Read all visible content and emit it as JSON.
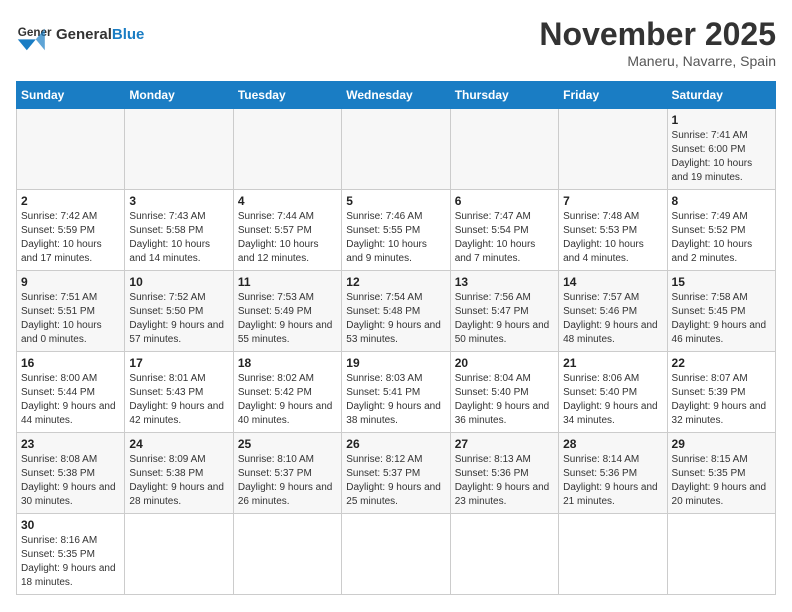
{
  "header": {
    "logo_general": "General",
    "logo_blue": "Blue",
    "month_title": "November 2025",
    "location": "Maneru, Navarre, Spain"
  },
  "days_of_week": [
    "Sunday",
    "Monday",
    "Tuesday",
    "Wednesday",
    "Thursday",
    "Friday",
    "Saturday"
  ],
  "weeks": [
    [
      {
        "day": "",
        "info": ""
      },
      {
        "day": "",
        "info": ""
      },
      {
        "day": "",
        "info": ""
      },
      {
        "day": "",
        "info": ""
      },
      {
        "day": "",
        "info": ""
      },
      {
        "day": "",
        "info": ""
      },
      {
        "day": "1",
        "info": "Sunrise: 7:41 AM\nSunset: 6:00 PM\nDaylight: 10 hours and 19 minutes."
      }
    ],
    [
      {
        "day": "2",
        "info": "Sunrise: 7:42 AM\nSunset: 5:59 PM\nDaylight: 10 hours and 17 minutes."
      },
      {
        "day": "3",
        "info": "Sunrise: 7:43 AM\nSunset: 5:58 PM\nDaylight: 10 hours and 14 minutes."
      },
      {
        "day": "4",
        "info": "Sunrise: 7:44 AM\nSunset: 5:57 PM\nDaylight: 10 hours and 12 minutes."
      },
      {
        "day": "5",
        "info": "Sunrise: 7:46 AM\nSunset: 5:55 PM\nDaylight: 10 hours and 9 minutes."
      },
      {
        "day": "6",
        "info": "Sunrise: 7:47 AM\nSunset: 5:54 PM\nDaylight: 10 hours and 7 minutes."
      },
      {
        "day": "7",
        "info": "Sunrise: 7:48 AM\nSunset: 5:53 PM\nDaylight: 10 hours and 4 minutes."
      },
      {
        "day": "8",
        "info": "Sunrise: 7:49 AM\nSunset: 5:52 PM\nDaylight: 10 hours and 2 minutes."
      }
    ],
    [
      {
        "day": "9",
        "info": "Sunrise: 7:51 AM\nSunset: 5:51 PM\nDaylight: 10 hours and 0 minutes."
      },
      {
        "day": "10",
        "info": "Sunrise: 7:52 AM\nSunset: 5:50 PM\nDaylight: 9 hours and 57 minutes."
      },
      {
        "day": "11",
        "info": "Sunrise: 7:53 AM\nSunset: 5:49 PM\nDaylight: 9 hours and 55 minutes."
      },
      {
        "day": "12",
        "info": "Sunrise: 7:54 AM\nSunset: 5:48 PM\nDaylight: 9 hours and 53 minutes."
      },
      {
        "day": "13",
        "info": "Sunrise: 7:56 AM\nSunset: 5:47 PM\nDaylight: 9 hours and 50 minutes."
      },
      {
        "day": "14",
        "info": "Sunrise: 7:57 AM\nSunset: 5:46 PM\nDaylight: 9 hours and 48 minutes."
      },
      {
        "day": "15",
        "info": "Sunrise: 7:58 AM\nSunset: 5:45 PM\nDaylight: 9 hours and 46 minutes."
      }
    ],
    [
      {
        "day": "16",
        "info": "Sunrise: 8:00 AM\nSunset: 5:44 PM\nDaylight: 9 hours and 44 minutes."
      },
      {
        "day": "17",
        "info": "Sunrise: 8:01 AM\nSunset: 5:43 PM\nDaylight: 9 hours and 42 minutes."
      },
      {
        "day": "18",
        "info": "Sunrise: 8:02 AM\nSunset: 5:42 PM\nDaylight: 9 hours and 40 minutes."
      },
      {
        "day": "19",
        "info": "Sunrise: 8:03 AM\nSunset: 5:41 PM\nDaylight: 9 hours and 38 minutes."
      },
      {
        "day": "20",
        "info": "Sunrise: 8:04 AM\nSunset: 5:40 PM\nDaylight: 9 hours and 36 minutes."
      },
      {
        "day": "21",
        "info": "Sunrise: 8:06 AM\nSunset: 5:40 PM\nDaylight: 9 hours and 34 minutes."
      },
      {
        "day": "22",
        "info": "Sunrise: 8:07 AM\nSunset: 5:39 PM\nDaylight: 9 hours and 32 minutes."
      }
    ],
    [
      {
        "day": "23",
        "info": "Sunrise: 8:08 AM\nSunset: 5:38 PM\nDaylight: 9 hours and 30 minutes."
      },
      {
        "day": "24",
        "info": "Sunrise: 8:09 AM\nSunset: 5:38 PM\nDaylight: 9 hours and 28 minutes."
      },
      {
        "day": "25",
        "info": "Sunrise: 8:10 AM\nSunset: 5:37 PM\nDaylight: 9 hours and 26 minutes."
      },
      {
        "day": "26",
        "info": "Sunrise: 8:12 AM\nSunset: 5:37 PM\nDaylight: 9 hours and 25 minutes."
      },
      {
        "day": "27",
        "info": "Sunrise: 8:13 AM\nSunset: 5:36 PM\nDaylight: 9 hours and 23 minutes."
      },
      {
        "day": "28",
        "info": "Sunrise: 8:14 AM\nSunset: 5:36 PM\nDaylight: 9 hours and 21 minutes."
      },
      {
        "day": "29",
        "info": "Sunrise: 8:15 AM\nSunset: 5:35 PM\nDaylight: 9 hours and 20 minutes."
      }
    ],
    [
      {
        "day": "30",
        "info": "Sunrise: 8:16 AM\nSunset: 5:35 PM\nDaylight: 9 hours and 18 minutes."
      },
      {
        "day": "",
        "info": ""
      },
      {
        "day": "",
        "info": ""
      },
      {
        "day": "",
        "info": ""
      },
      {
        "day": "",
        "info": ""
      },
      {
        "day": "",
        "info": ""
      },
      {
        "day": "",
        "info": ""
      }
    ]
  ]
}
